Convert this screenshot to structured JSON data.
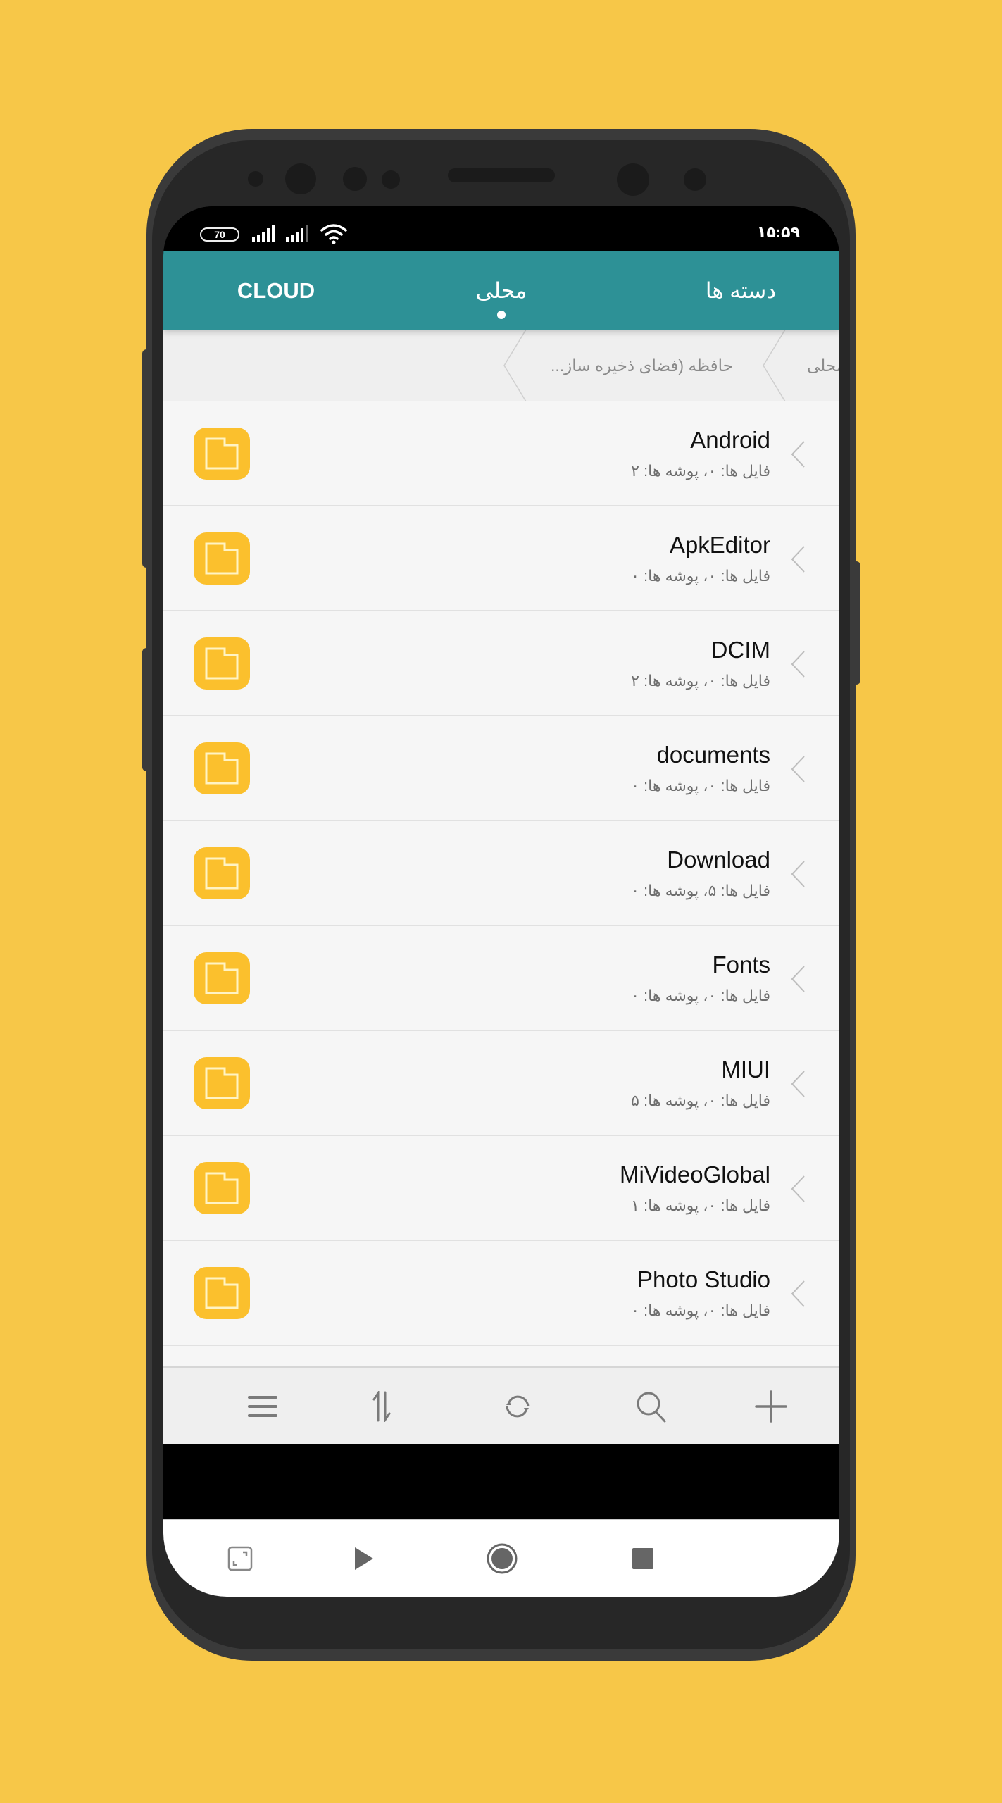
{
  "statusbar": {
    "battery": "70",
    "time": "۱۵:۵۹",
    "icons": [
      "battery-icon",
      "signal-icon",
      "signal-icon",
      "wifi-icon"
    ]
  },
  "tabs": [
    {
      "label": "CLOUD",
      "active": false
    },
    {
      "label": "محلی",
      "active": true
    },
    {
      "label": "دسته ها",
      "active": false
    }
  ],
  "breadcrumb": [
    {
      "label": "محلی"
    },
    {
      "label": "حافظه (فضای ذخیره ساز..."
    }
  ],
  "colors": {
    "accent": "#2D9196",
    "folder": "#FBC02D",
    "background": "#F7C748"
  },
  "folders": [
    {
      "name": "Android",
      "info": "فایل ها: ۰، پوشه ها: ۲"
    },
    {
      "name": "ApkEditor",
      "info": "فایل ها: ۰، پوشه ها: ۰"
    },
    {
      "name": "DCIM",
      "info": "فایل ها: ۰، پوشه ها: ۲"
    },
    {
      "name": "documents",
      "info": "فایل ها: ۰، پوشه ها: ۰"
    },
    {
      "name": "Download",
      "info": "فایل ها: ۵، پوشه ها: ۰"
    },
    {
      "name": "Fonts",
      "info": "فایل ها: ۰، پوشه ها: ۰"
    },
    {
      "name": "MIUI",
      "info": "فایل ها: ۰، پوشه ها: ۵"
    },
    {
      "name": "MiVideoGlobal",
      "info": "فایل ها: ۰، پوشه ها: ۱"
    },
    {
      "name": "Photo Studio",
      "info": "فایل ها: ۰، پوشه ها: ۰"
    }
  ],
  "toolbar": {
    "items": [
      "menu-icon",
      "sort-icon",
      "refresh-icon",
      "search-icon",
      "add-icon"
    ]
  },
  "navbar": {
    "items": [
      "screenshot-icon",
      "play-icon",
      "home-icon",
      "stop-icon"
    ]
  }
}
